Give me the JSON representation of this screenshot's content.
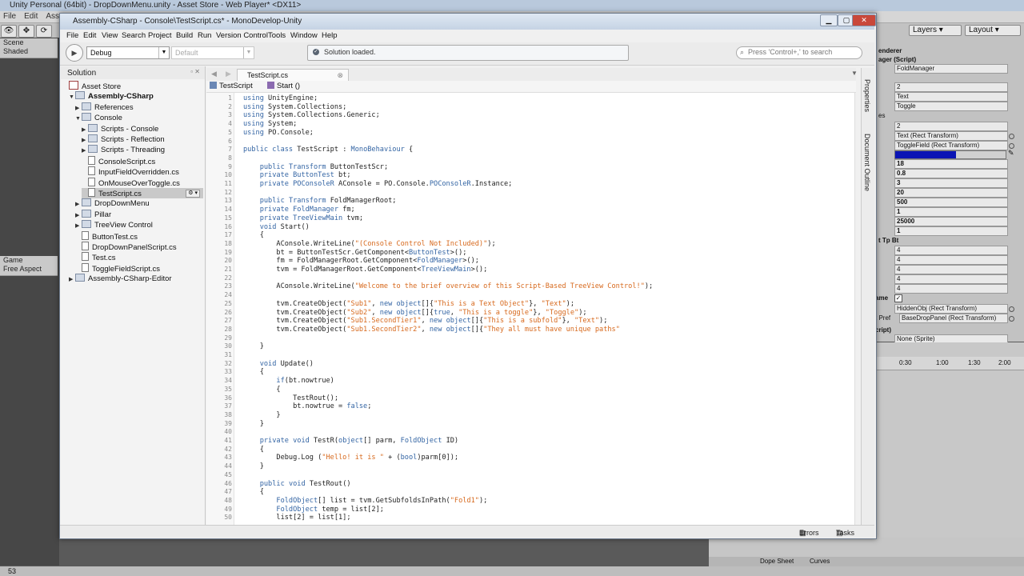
{
  "unity": {
    "title": "Unity Personal (64bit) - DropDownMenu.unity - Asset Store - Web Player* <DX11>",
    "menu": [
      "File",
      "Edit",
      "Assets"
    ],
    "layers": "Layers",
    "layout": "Layout",
    "scene_tab": "Scene",
    "scene_mode": "Shaded",
    "game_tab": "Game",
    "game_aspect": "Free Aspect",
    "status_count": "53",
    "inspector": {
      "header_label": "ager (Script)",
      "foldmanager": "FoldManager",
      "rows_top": [
        "2",
        "Text",
        "Toggle"
      ],
      "rows_mid": [
        "2",
        "Text (Rect Transform)",
        "ToggleField (Rect Transform)"
      ],
      "es_label": "es",
      "values": [
        "18",
        "0.8",
        "3",
        "20",
        "500",
        "1",
        "25000",
        "1"
      ],
      "tp_label": "t Tp Bt",
      "fours": [
        "4",
        "4",
        "4",
        "4",
        "4"
      ],
      "ame_label": "ame",
      "hidden_obj": "HiddenObj (Rect Transform)",
      "prefab_label": "t Pref",
      "base_drop": "BaseDropPanel (Rect Transform)",
      "script_label": "cript)",
      "none_sprite": "None (Sprite)",
      "enderer_label": "enderer",
      "progress_fill": 0.55,
      "accent_color": "#0a14b4"
    },
    "timeline": [
      "0:30",
      "1:00",
      "1:30",
      "2:00"
    ],
    "dope_sheet": "Dope Sheet",
    "curves": "Curves"
  },
  "md": {
    "title": "Assembly-CSharp - Console\\TestScript.cs* - MonoDevelop-Unity",
    "menu": [
      "File",
      "Edit",
      "View",
      "Search",
      "Project",
      "Build",
      "Run",
      "Version Control",
      "Tools",
      "Window",
      "Help"
    ],
    "config": "Debug",
    "platform": "Default",
    "status": "Solution loaded.",
    "search_placeholder": "Press 'Control+,' to search",
    "solution_title": "Solution",
    "tab": "TestScript.cs",
    "breadcrumb_class": "TestScript",
    "breadcrumb_method": "Start ()",
    "side_pads": [
      "Properties",
      "Document Outline"
    ],
    "status_errors": "Errors",
    "status_tasks": "Tasks",
    "tree": [
      {
        "label": "Asset Store",
        "kind": "solution"
      },
      {
        "label": "Assembly-CSharp",
        "kind": "folder"
      },
      {
        "label": "References",
        "kind": "folder"
      },
      {
        "label": "Console",
        "kind": "folder"
      },
      {
        "label": "Scripts - Console",
        "kind": "folder"
      },
      {
        "label": "Scripts - Reflection",
        "kind": "folder"
      },
      {
        "label": "Scripts - Threading",
        "kind": "folder"
      },
      {
        "label": "ConsoleScript.cs",
        "kind": "file"
      },
      {
        "label": "InputFieldOverridden.cs",
        "kind": "file"
      },
      {
        "label": "OnMouseOverToggle.cs",
        "kind": "file"
      },
      {
        "label": "TestScript.cs",
        "kind": "file"
      },
      {
        "label": "DropDownMenu",
        "kind": "folder"
      },
      {
        "label": "Pillar",
        "kind": "folder"
      },
      {
        "label": "TreeView Control",
        "kind": "folder"
      },
      {
        "label": "ButtonTest.cs",
        "kind": "file"
      },
      {
        "label": "DropDownPanelScript.cs",
        "kind": "file"
      },
      {
        "label": "Test.cs",
        "kind": "file"
      },
      {
        "label": "ToggleFieldScript.cs",
        "kind": "file"
      },
      {
        "label": "Assembly-CSharp-Editor",
        "kind": "folder"
      }
    ],
    "code": [
      "using UnityEngine;",
      "using System.Collections;",
      "using System.Collections.Generic;",
      "using System;",
      "using PO.Console;",
      "",
      "public class TestScript : MonoBehaviour {",
      "",
      "    public Transform ButtonTestScr;",
      "    private ButtonTest bt;",
      "    private POConsoleR AConsole = PO.Console.POConsoleR.Instance;",
      "",
      "    public Transform FoldManagerRoot;",
      "    private FoldManager fm;",
      "    private TreeViewMain tvm;",
      "    void Start()",
      "    {",
      "        AConsole.WriteLine(\"(Console Control Not Included)\");",
      "        bt = ButtonTestScr.GetComponent<ButtonTest>();",
      "        fm = FoldManagerRoot.GetComponent<FoldManager>();",
      "        tvm = FoldManagerRoot.GetComponent<TreeViewMain>();",
      "",
      "        AConsole.WriteLine(\"Welcome to the brief overview of this Script-Based TreeView Control!\");",
      "",
      "        tvm.CreateObject(\"Sub1\", new object[]{\"This is a Text Object\"}, \"Text\");",
      "        tvm.CreateObject(\"Sub2\", new object[]{true, \"This is a toggle\"}, \"Toggle\");",
      "        tvm.CreateObject(\"Sub1.SecondTier1\", new object[]{\"This is a subfold\"}, \"Text\");",
      "        tvm.CreateObject(\"Sub1.SecondTier2\", new object[]{\"They all must have unique paths\"",
      "",
      "    }",
      "",
      "    void Update()",
      "    {",
      "        if(bt.nowtrue)",
      "        {",
      "            TestRout();",
      "            bt.nowtrue = false;",
      "        }",
      "    }",
      "",
      "    private void TestR(object[] parm, FoldObject ID)",
      "    {",
      "        Debug.Log (\"Hello! it is \" + (bool)parm[0]);",
      "    }",
      "",
      "    public void TestRout()",
      "    {",
      "        FoldObject[] list = tvm.GetSubfoldsInPath(\"Fold1\");",
      "        FoldObject temp = list[2];",
      "        list[2] = list[1];"
    ]
  }
}
